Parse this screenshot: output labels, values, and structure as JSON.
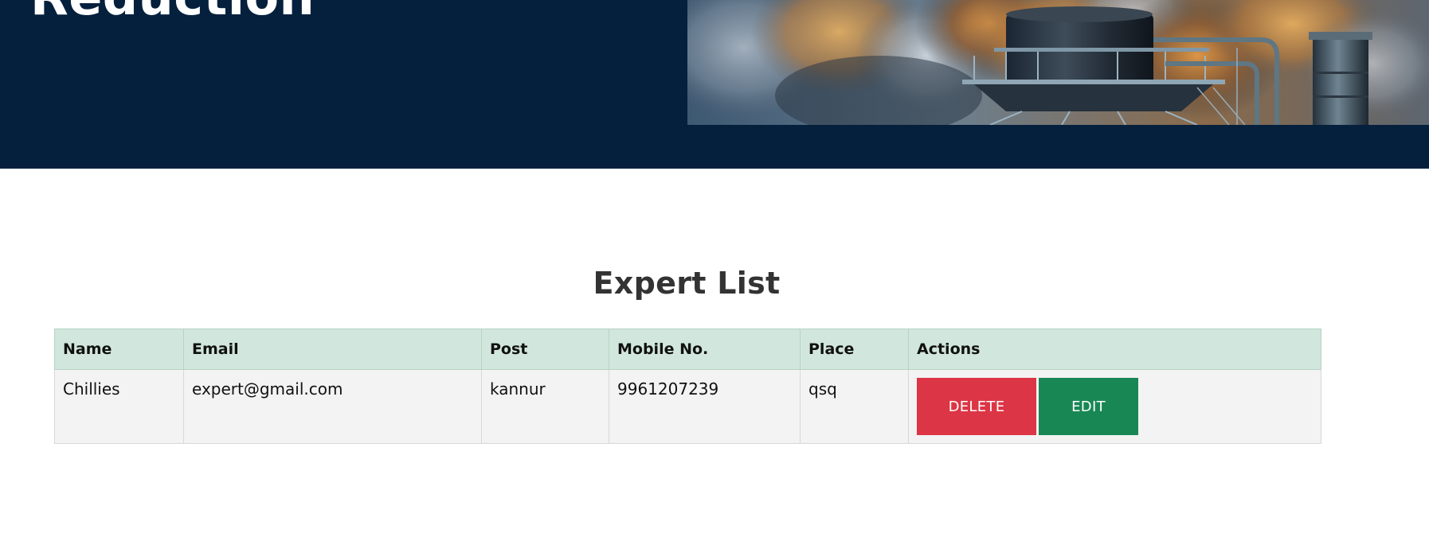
{
  "hero": {
    "title": "Reduction",
    "image_alt": "factory-smokestacks"
  },
  "section": {
    "title": "Expert List"
  },
  "table": {
    "headers": {
      "name": "Name",
      "email": "Email",
      "post": "Post",
      "mobile": "Mobile No.",
      "place": "Place",
      "actions": "Actions"
    },
    "rows": [
      {
        "name": "Chillies",
        "email": "expert@gmail.com",
        "post": "kannur",
        "mobile": "9961207239",
        "place": "qsq",
        "delete_label": "DELETE",
        "edit_label": "EDIT"
      }
    ]
  },
  "colors": {
    "hero_bg": "#05203d",
    "header_bg": "#d1e7dd",
    "row_bg": "#f3f3f3",
    "delete": "#dc3545",
    "edit": "#198754"
  }
}
